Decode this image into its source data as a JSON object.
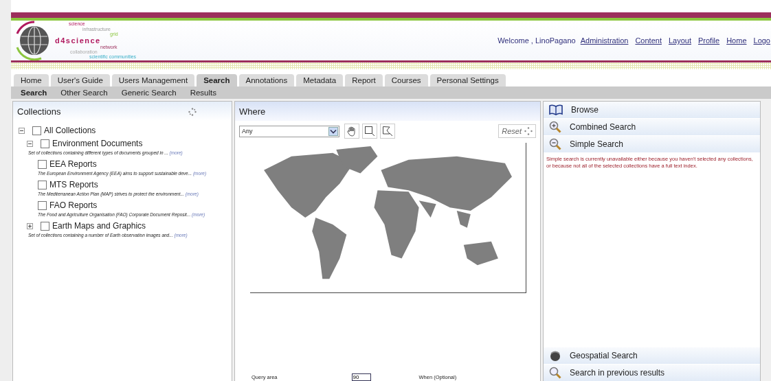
{
  "logo": {
    "words": [
      "science",
      "infrastructure",
      "grid",
      "d4science",
      "network",
      "collaboration",
      "scientific communities"
    ]
  },
  "header": {
    "welcome": "Welcome , LinoPagano",
    "links": [
      "Administration",
      "Content",
      "Layout",
      "Profile",
      "Home",
      "Logo"
    ]
  },
  "tabs": [
    {
      "label": "Home",
      "selected": false
    },
    {
      "label": "User's Guide",
      "selected": false
    },
    {
      "label": "Users Management",
      "selected": false
    },
    {
      "label": "Search",
      "selected": true
    },
    {
      "label": "Annotations",
      "selected": false
    },
    {
      "label": "Metadata",
      "selected": false
    },
    {
      "label": "Report",
      "selected": false
    },
    {
      "label": "Courses",
      "selected": false
    },
    {
      "label": "Personal Settings",
      "selected": false
    }
  ],
  "subtabs": [
    {
      "label": "Search",
      "selected": true
    },
    {
      "label": "Other Search",
      "selected": false
    },
    {
      "label": "Generic Search",
      "selected": false
    },
    {
      "label": "Results",
      "selected": false
    }
  ],
  "collections": {
    "title": "Collections",
    "tree": [
      {
        "label": "All Collections",
        "checked": false,
        "expanded": true,
        "children": [
          {
            "label": "Environment Documents",
            "checked": false,
            "expanded": true,
            "description": "Set of collections containing different types of documents grouped in ...",
            "more": "(more)",
            "children": [
              {
                "label": "EEA Reports",
                "checked": false,
                "description": "The European Environment Agency (EEA) aims to support sustainable deve...",
                "more": "(more)"
              },
              {
                "label": "MTS Reports",
                "checked": false,
                "description": "The Mediterranean Action Plan (MAP) strives to protect the environment...",
                "more": "(more)"
              },
              {
                "label": "FAO Reports",
                "checked": false,
                "description": "The Food and Agriculture Organisation (FAO) Corporate Document Reposit...",
                "more": "(more)"
              }
            ]
          },
          {
            "label": "Earth Maps and Graphics",
            "checked": false,
            "expanded": false,
            "description": "Set of collections containing a number of Earth observation images and...",
            "more": "(more)"
          }
        ]
      }
    ]
  },
  "where": {
    "title": "Where",
    "area_select": "Any",
    "reset": "Reset",
    "query_area_label": "Query area",
    "query_area_value": "90",
    "when_label": "When (Optional)"
  },
  "search_types": [
    {
      "label": "Browse",
      "kind": "book"
    },
    {
      "label": "Combined Search",
      "kind": "zoom-in"
    },
    {
      "label": "Simple Search",
      "kind": "zoom-out",
      "message": "Simple search is currently unavailable either because you haven't selected any collections, or because not all of the selected collections have a full text index."
    },
    {
      "label": "Geospatial Search",
      "kind": "globe"
    },
    {
      "label": "Search in previous results",
      "kind": "magnifier"
    }
  ]
}
